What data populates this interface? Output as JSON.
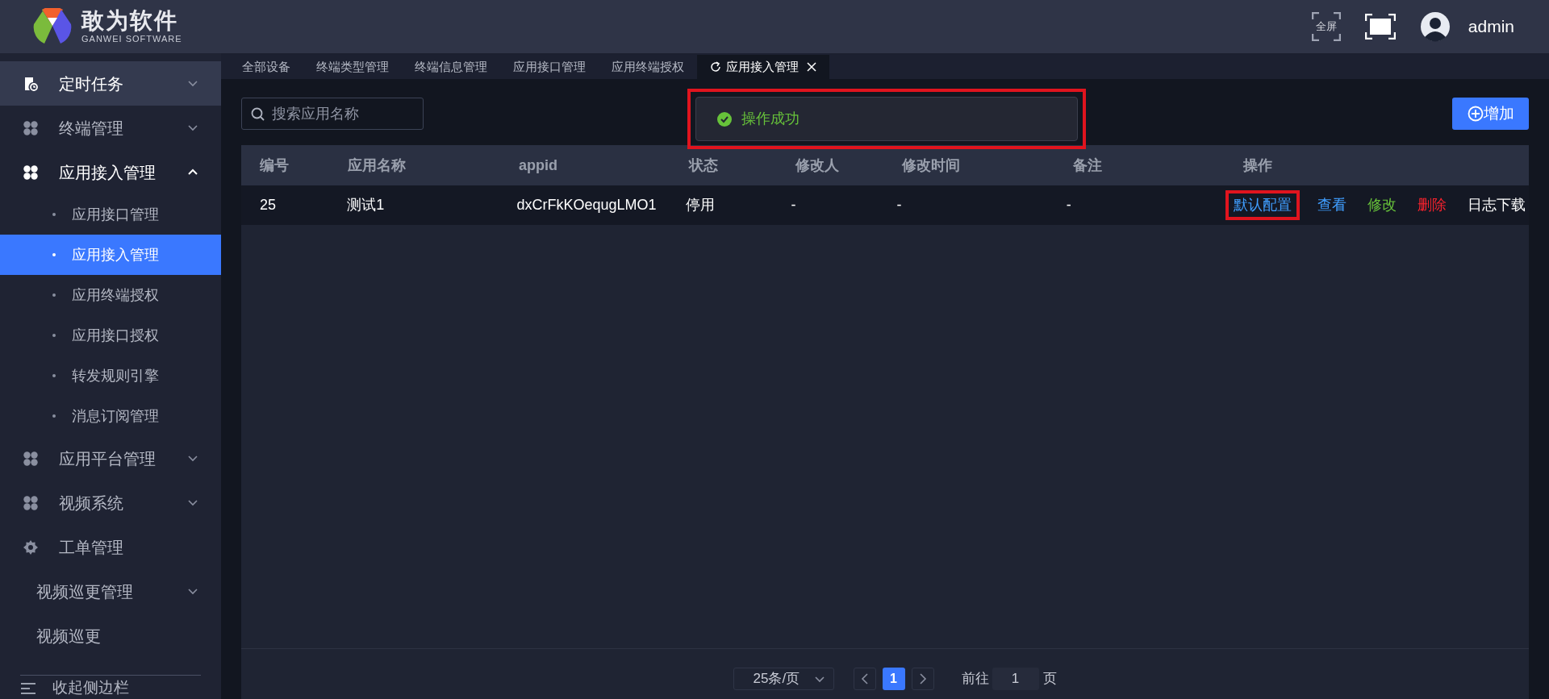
{
  "header": {
    "logo_title": "敢为软件",
    "logo_subtitle": "GANWEI SOFTWARE",
    "fullscreen_label": "全屏",
    "user": "admin"
  },
  "sidebar": {
    "items": [
      {
        "kind": "group",
        "label": "定时任务",
        "expanded": false,
        "highlighted": true
      },
      {
        "kind": "group",
        "label": "终端管理",
        "expanded": false,
        "highlighted": false
      },
      {
        "kind": "group",
        "label": "应用接入管理",
        "expanded": true,
        "highlighted": false,
        "children": [
          {
            "label": "应用接口管理",
            "selected": false
          },
          {
            "label": "应用接入管理",
            "selected": true
          },
          {
            "label": "应用终端授权",
            "selected": false
          },
          {
            "label": "应用接口授权",
            "selected": false
          },
          {
            "label": "转发规则引擎",
            "selected": false
          },
          {
            "label": "消息订阅管理",
            "selected": false
          }
        ]
      },
      {
        "kind": "group",
        "label": "应用平台管理",
        "expanded": false,
        "highlighted": false
      },
      {
        "kind": "group",
        "label": "视频系统",
        "expanded": false,
        "highlighted": false
      },
      {
        "kind": "gear",
        "label": "工单管理",
        "highlighted": false
      },
      {
        "kind": "plain",
        "label": "视频巡更管理",
        "expanded": false,
        "highlighted": false
      },
      {
        "kind": "plain",
        "label": "视频巡更",
        "highlighted": false
      }
    ],
    "collapse_label": "收起侧边栏"
  },
  "tabs": [
    {
      "label": "全部设备",
      "selected": false
    },
    {
      "label": "终端类型管理",
      "selected": false
    },
    {
      "label": "终端信息管理",
      "selected": false
    },
    {
      "label": "应用接口管理",
      "selected": false
    },
    {
      "label": "应用终端授权",
      "selected": false
    },
    {
      "label": "应用接入管理",
      "selected": true
    }
  ],
  "search": {
    "placeholder": "搜索应用名称"
  },
  "toast": {
    "message": "操作成功",
    "highlighted": true
  },
  "add_button": "增加",
  "table": {
    "columns": [
      "编号",
      "应用名称",
      "appid",
      "状态",
      "修改人",
      "修改时间",
      "备注",
      "操作"
    ],
    "rows": [
      {
        "cells": [
          "25",
          "测试1",
          "dxCrFkKOequgLMO1",
          "停用",
          "-",
          "-",
          "-"
        ],
        "actions": [
          {
            "label": "默认配置",
            "color": "#409eff",
            "highlighted": true
          },
          {
            "label": "查看",
            "color": "#409eff",
            "highlighted": false
          },
          {
            "label": "修改",
            "color": "#67c23a",
            "highlighted": false
          },
          {
            "label": "删除",
            "color": "#f5222d",
            "highlighted": false
          },
          {
            "label": "日志下载",
            "color": "#ffffff",
            "highlighted": false
          }
        ]
      }
    ]
  },
  "pagination": {
    "page_size": "25条/页",
    "pages": [
      {
        "label": "1",
        "selected": true
      }
    ],
    "goto_label": "前往",
    "goto_value": "1",
    "goto_suffix": "页"
  }
}
